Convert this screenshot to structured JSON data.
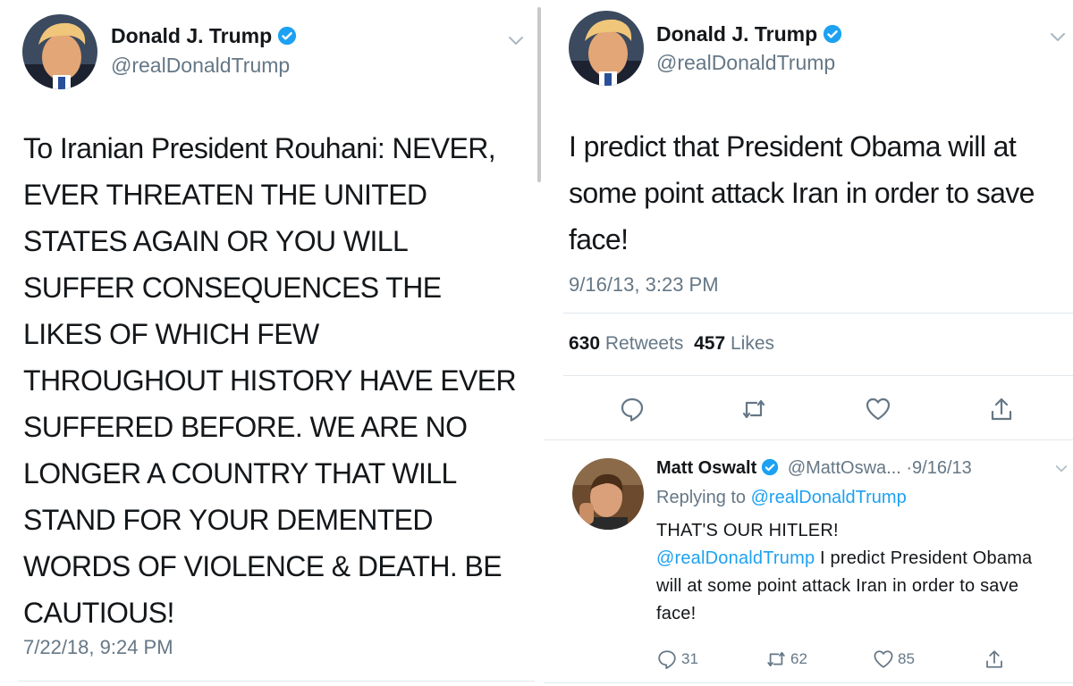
{
  "left_tweet": {
    "author_name": "Donald J. Trump",
    "author_handle": "@realDonaldTrump",
    "text": "To Iranian President Rouhani: NEVER, EVER THREATEN THE UNITED STATES AGAIN OR YOU WILL SUFFER CONSEQUENCES THE LIKES OF WHICH FEW THROUGHOUT HISTORY HAVE EVER SUFFERED BEFORE. WE ARE NO LONGER A COUNTRY THAT WILL STAND FOR YOUR DEMENTED WORDS OF VIOLENCE & DEATH. BE CAUTIOUS!",
    "timestamp": "7/22/18, 9:24 PM"
  },
  "right_tweet": {
    "author_name": "Donald J. Trump",
    "author_handle": "@realDonaldTrump",
    "text": "I predict that President Obama will at some point attack Iran in order to save face!",
    "timestamp": "9/16/13, 3:23 PM",
    "retweet_count": "630",
    "retweet_label": "Retweets",
    "like_count": "457",
    "like_label": "Likes"
  },
  "reply": {
    "author_name": "Matt Oswalt",
    "author_handle": "@MattOswa...",
    "separator": "·",
    "date": "9/16/13",
    "replying_to_label": "Replying to",
    "replying_to_handle": "@realDonaldTrump",
    "text_line1": "THAT'S OUR HITLER!",
    "mention": "@realDonaldTrump",
    "text_rest": "I predict President Obama will at some point attack Iran in order to save face!",
    "reply_count": "31",
    "retweet_count": "62",
    "like_count": "85"
  },
  "icons": {
    "verified": "verified-badge-icon",
    "chevron": "chevron-down-icon",
    "reply": "reply-icon",
    "retweet": "retweet-icon",
    "like": "heart-icon",
    "share": "share-icon"
  },
  "colors": {
    "accent": "#1da1f2",
    "text": "#14171a",
    "secondary": "#657786",
    "divider": "#e1e8ed"
  }
}
